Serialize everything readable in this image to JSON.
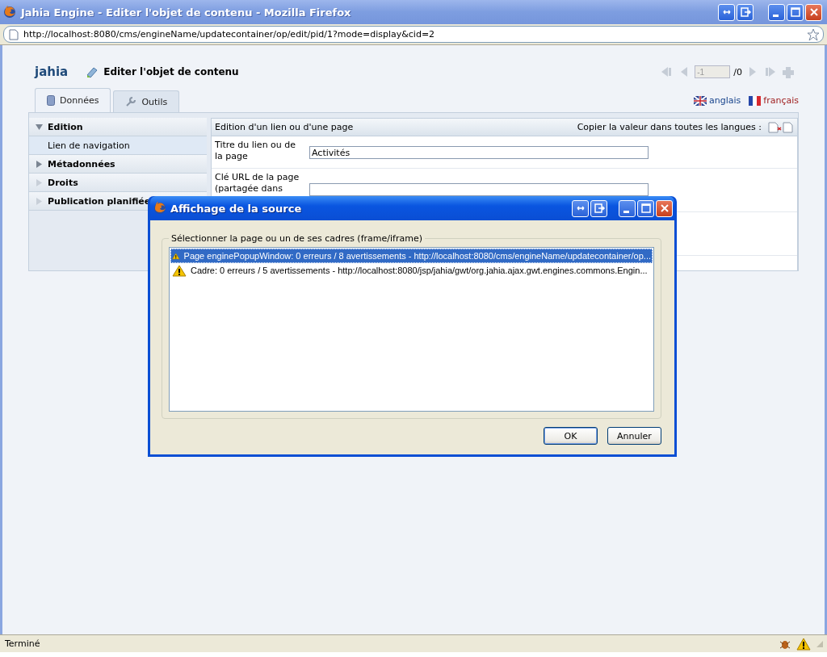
{
  "window": {
    "title": "Jahia Engine - Editer l'objet de contenu - Mozilla Firefox"
  },
  "address_bar": {
    "url": "http://localhost:8080/cms/engineName/updatecontainer/op/edit/pid/1?mode=display&cid=2"
  },
  "engine": {
    "logo": "jahia",
    "title": "Editer l'objet de contenu",
    "pager": {
      "value": "-1",
      "total": "/0"
    },
    "tabs": [
      {
        "label": "Données",
        "selected": true
      },
      {
        "label": "Outils",
        "selected": false
      }
    ],
    "languages": [
      {
        "label": "anglais",
        "selected": false
      },
      {
        "label": "français",
        "selected": true
      }
    ],
    "sidebar": [
      {
        "label": "Edition",
        "expanded": true,
        "disabled": false,
        "children": [
          {
            "label": "Lien de navigation"
          }
        ]
      },
      {
        "label": "Métadonnées",
        "expanded": false,
        "disabled": false
      },
      {
        "label": "Droits",
        "expanded": false,
        "disabled": true
      },
      {
        "label": "Publication planifiée",
        "expanded": false,
        "disabled": true
      }
    ],
    "form": {
      "title": "Edition d'un lien ou d'une page",
      "copy_label": "Copier la valeur dans toutes les langues :",
      "fields": [
        {
          "label": "Titre du lien ou de la page",
          "value": "Activités"
        },
        {
          "label": "Clé URL de la page (partagée dans"
        }
      ]
    }
  },
  "dialog": {
    "title": "Affichage de la source",
    "group_label": "Sélectionner la page ou un de ses cadres (frame/iframe)",
    "items": [
      {
        "text": "Page enginePopupWindow: 0 erreurs / 8 avertissements - http://localhost:8080/cms/engineName/updatecontainer/op...",
        "selected": true
      },
      {
        "text": "Cadre: 0 erreurs / 5 avertissements - http://localhost:8080/jsp/jahia/gwt/org.jahia.ajax.gwt.engines.commons.Engin...",
        "selected": false
      }
    ],
    "buttons": [
      "OK",
      "Annuler"
    ]
  },
  "status_bar": {
    "text": "Terminé"
  }
}
